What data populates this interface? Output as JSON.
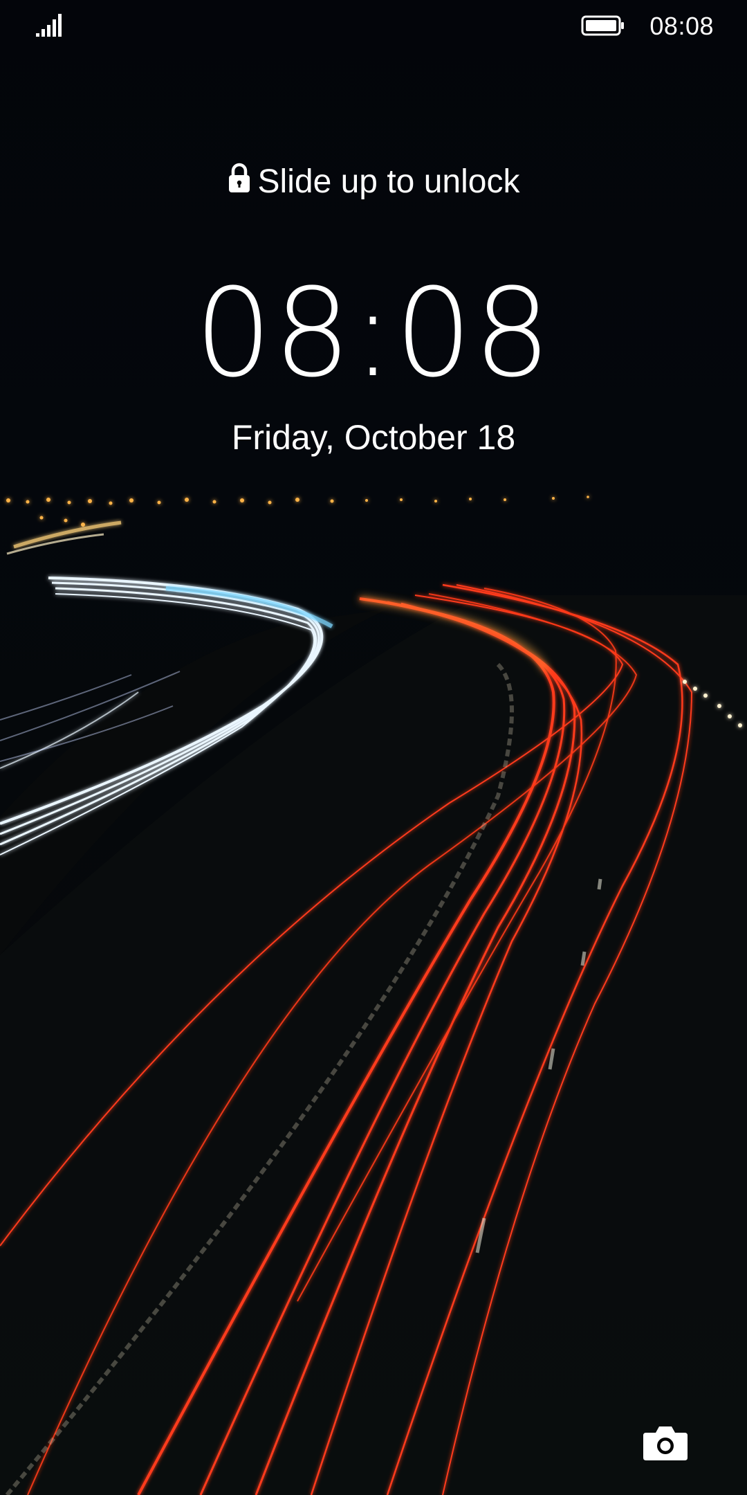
{
  "status_bar": {
    "time": "08:08",
    "signal_icon": "signal-bars-icon",
    "battery_icon": "battery-full-icon"
  },
  "lock_screen": {
    "unlock_hint": "Slide up to unlock",
    "lock_icon": "lock-icon",
    "clock": "08:08",
    "date": "Friday, October 18",
    "camera_icon": "camera-icon"
  },
  "colors": {
    "background": "#000000",
    "text": "#ffffff",
    "tail_lights": "#ff3a1a",
    "head_lights": "#e8f4ff"
  }
}
